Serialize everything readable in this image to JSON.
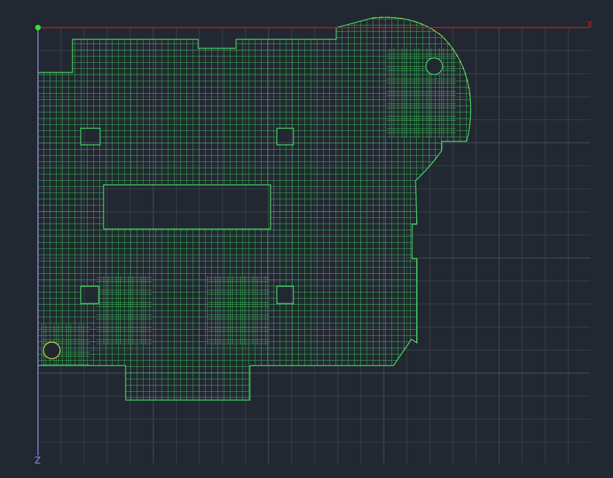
{
  "axes": {
    "x_label": "X",
    "z_label": "Z"
  },
  "colors": {
    "background": "#222831",
    "grid_minor": "#39404b",
    "grid_major": "#4a525e",
    "x_axis": "#d1141a",
    "z_axis": "#8a86e6",
    "mesh_line": "#3ccf5a",
    "mesh_edge": "#4ae06a",
    "mesh_warning": "#d6e03c",
    "origin": "#2ee82e"
  }
}
